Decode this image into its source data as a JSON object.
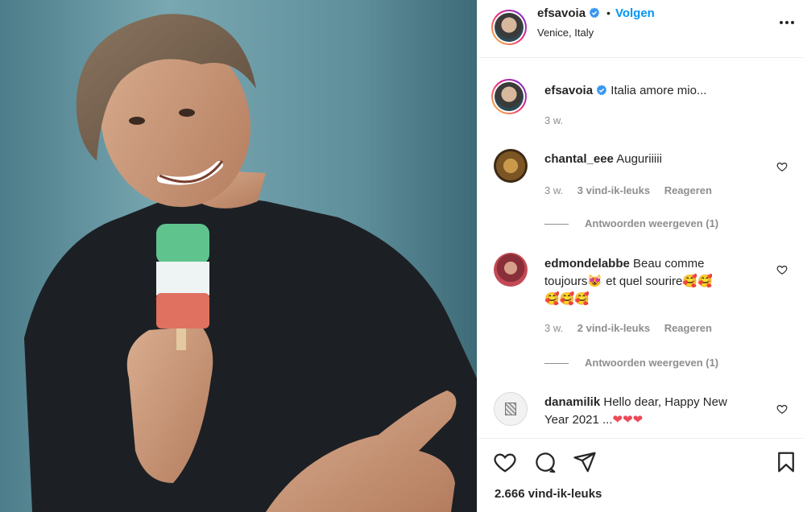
{
  "post": {
    "username": "efsavoia",
    "follow_label": "Volgen",
    "location": "Venice, Italy",
    "caption": "Italia amore mio...",
    "caption_time": "3 w.",
    "likes": "2.666 vind-ik-leuks"
  },
  "comments": [
    {
      "username": "chantal_eee",
      "text": "Auguriiiii",
      "time": "3 w.",
      "likes": "3 vind-ik-leuks",
      "reply": "Reageren",
      "view_replies": "Antwoorden weergeven (1)"
    },
    {
      "username": "edmondelabbe",
      "text_line1": "Beau comme",
      "text_line2a": "toujours",
      "text_line2b": " et quel sourire",
      "emoji_heart_eyes_cat": "😻",
      "emoji_smiling_hearts": "🥰",
      "time": "3 w.",
      "likes": "2 vind-ik-leuks",
      "reply": "Reageren",
      "view_replies": "Antwoorden weergeven (1)"
    },
    {
      "username": "danamilik",
      "text_line1": "Hello dear, Happy New",
      "text_line2": "Year 2021 ...",
      "emoji_heart": "❤"
    }
  ],
  "icons": {
    "heart": "heart-icon",
    "comment": "comment-icon",
    "share": "paper-plane-icon",
    "save": "bookmark-icon",
    "more": "more-options-icon",
    "verified": "verified-badge-icon"
  },
  "colors": {
    "link_blue": "#0095f6",
    "verified_blue": "#3897f0",
    "secondary_text": "#8e8e8e",
    "heart_red": "#ed4956"
  }
}
